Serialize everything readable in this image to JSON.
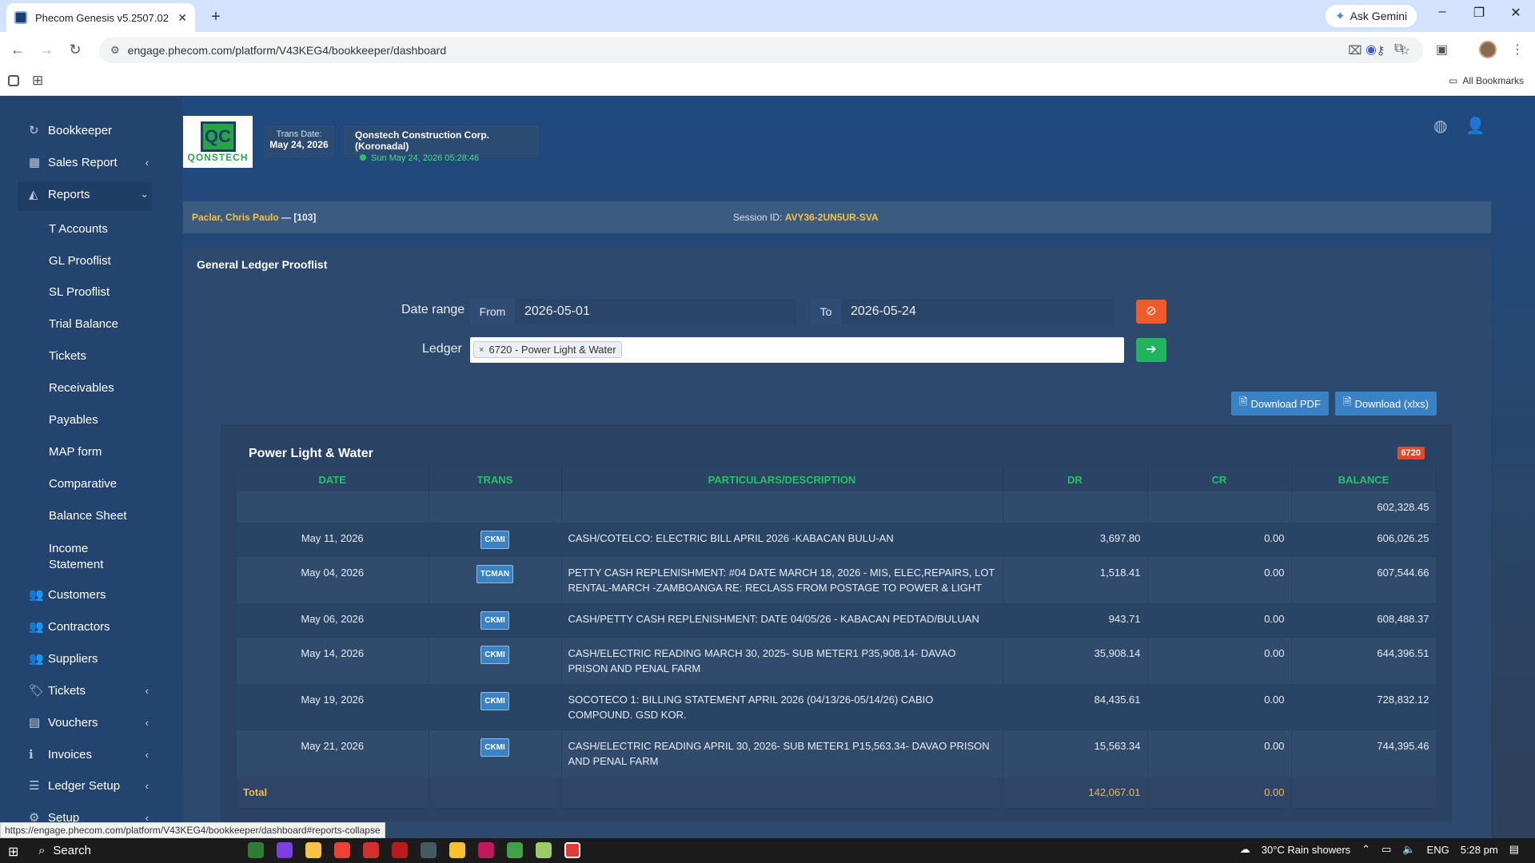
{
  "browser": {
    "tab_title": "Phecom Genesis v5.2507.02",
    "tab_close": "✕",
    "new_tab": "+",
    "gemini_label": "Ask Gemini",
    "url": "engage.phecom.com/platform/V43KEG4/bookkeeper/dashboard",
    "all_bookmarks": "All Bookmarks",
    "status_url": "https://engage.phecom.com/platform/V43KEG4/bookkeeper/dashboard#reports-collapse"
  },
  "sidebar": {
    "top_items": [
      {
        "label": "Bookkeeper",
        "icon": "refresh-icon"
      },
      {
        "label": "Sales Report",
        "icon": "grid-icon"
      },
      {
        "label": "Reports",
        "icon": "chart-area-icon"
      }
    ],
    "report_items": [
      "T Accounts",
      "GL Prooflist",
      "SL Prooflist",
      "Trial Balance",
      "Tickets",
      "Receivables",
      "Payables",
      "MAP form",
      "Comparative",
      "Balance Sheet",
      "Income",
      "Statement"
    ],
    "bottom_items": [
      {
        "label": "Customers",
        "icon": "users-icon"
      },
      {
        "label": "Contractors",
        "icon": "users-icon"
      },
      {
        "label": "Suppliers",
        "icon": "users-icon"
      },
      {
        "label": "Tickets",
        "icon": "tag-icon"
      },
      {
        "label": "Vouchers",
        "icon": "file-icon"
      },
      {
        "label": "Invoices",
        "icon": "info-icon"
      },
      {
        "label": "Ledger Setup",
        "icon": "list-icon"
      },
      {
        "label": "Setup",
        "icon": "gear-icon"
      }
    ]
  },
  "header": {
    "logo_text": "QONSTECH",
    "trans_date_label": "Trans Date:",
    "trans_date": "May 24, 2026",
    "company": "Qonstech Construction Corp. (Koronadal)",
    "clock": "Sun May 24, 2026 05:28:46"
  },
  "userbar": {
    "user": "Paclar, Chris Paulo",
    "user_id": " — [103]",
    "session_label": "Session ID: ",
    "session_id": "AVY36-2UN5UR-SVA"
  },
  "panel": {
    "title": "General Ledger Prooflist",
    "date_range_label": "Date range",
    "from_label": "From",
    "from_value": "2026-05-01",
    "to_label": "To",
    "to_value": "2026-05-24",
    "ledger_label": "Ledger",
    "ledger_chip": "6720 - Power Light & Water",
    "download_pdf": "Download PDF",
    "download_xlsx": "Download (xlxs)"
  },
  "ledger": {
    "title": "Power Light & Water",
    "code": "6720",
    "columns": [
      "DATE",
      "TRANS",
      "PARTICULARS/DESCRIPTION",
      "DR",
      "CR",
      "BALANCE"
    ],
    "opening_balance": "602,328.45",
    "rows": [
      {
        "date": "May 11, 2026",
        "trans": "CKMI",
        "desc": "CASH/COTELCO: ELECTRIC BILL APRIL 2026 -KABACAN BULU-AN",
        "dr": "3,697.80",
        "cr": "0.00",
        "balance": "606,026.25"
      },
      {
        "date": "May 04, 2026",
        "trans": "TCMAN",
        "desc": "PETTY CASH REPLENISHMENT: #04 DATE MARCH 18, 2026 - MIS, ELEC,REPAIRS, LOT RENTAL-MARCH -ZAMBOANGA RE: RECLASS FROM POSTAGE TO POWER & LIGHT",
        "dr": "1,518.41",
        "cr": "0.00",
        "balance": "607,544.66"
      },
      {
        "date": "May 06, 2026",
        "trans": "CKMI",
        "desc": "CASH/PETTY CASH REPLENISHMENT: DATE 04/05/26 - KABACAN PEDTAD/BULUAN",
        "dr": "943.71",
        "cr": "0.00",
        "balance": "608,488.37"
      },
      {
        "date": "May 14, 2026",
        "trans": "CKMI",
        "desc": "CASH/ELECTRIC READING MARCH 30, 2025- SUB METER1 P35,908.14- DAVAO PRISON AND PENAL FARM",
        "dr": "35,908.14",
        "cr": "0.00",
        "balance": "644,396.51"
      },
      {
        "date": "May 19, 2026",
        "trans": "CKMI",
        "desc": "SOCOTECO 1: BILLING STATEMENT APRIL 2026 (04/13/26-05/14/26) CABIO COMPOUND. GSD KOR.",
        "dr": "84,435.61",
        "cr": "0.00",
        "balance": "728,832.12"
      },
      {
        "date": "May 21, 2026",
        "trans": "CKMI",
        "desc": "CASH/ELECTRIC READING APRIL 30, 2026- SUB METER1 P15,563.34- DAVAO PRISON AND PENAL FARM",
        "dr": "15,563.34",
        "cr": "0.00",
        "balance": "744,395.46"
      }
    ],
    "total_label": "Total",
    "total_dr": "142,067.01",
    "total_cr": "0.00"
  },
  "taskbar": {
    "search": "Search",
    "weather": "30°C  Rain showers",
    "lang": "ENG",
    "time": "5:28 pm"
  }
}
